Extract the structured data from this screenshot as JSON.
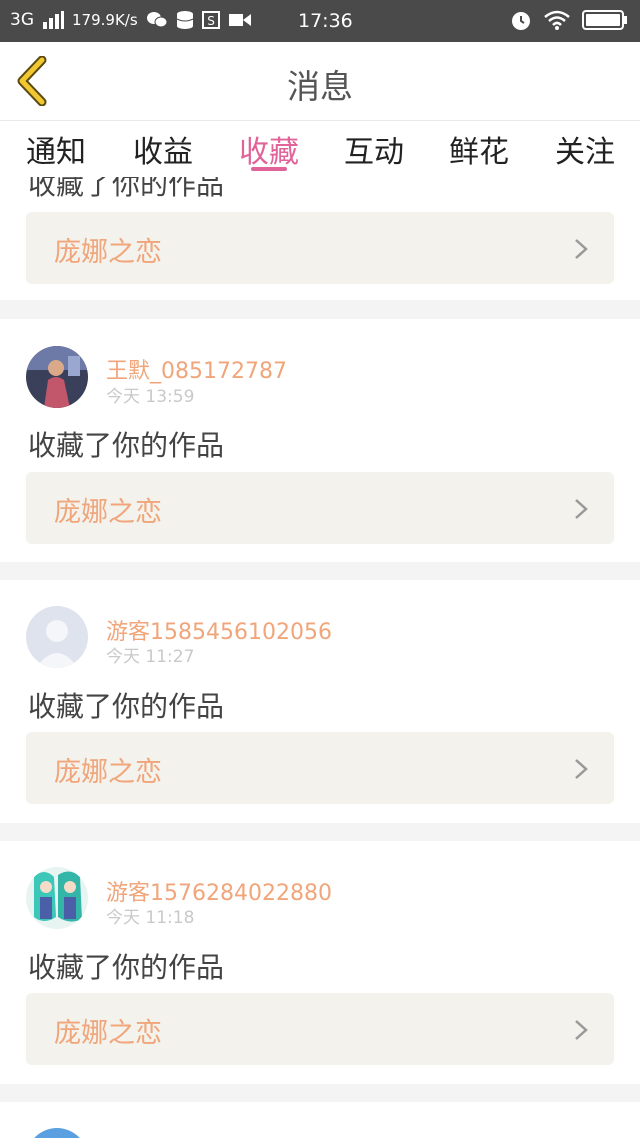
{
  "status_bar": {
    "network": "3G",
    "speed": "179.9K/s",
    "time": "17:36"
  },
  "header": {
    "title": "消息"
  },
  "tabs": [
    {
      "label": "通知",
      "active": false
    },
    {
      "label": "收益",
      "active": false
    },
    {
      "label": "收藏",
      "active": true
    },
    {
      "label": "互动",
      "active": false
    },
    {
      "label": "鲜花",
      "active": false
    },
    {
      "label": "关注",
      "active": false
    }
  ],
  "colors": {
    "accent": "#e0649a",
    "username": "#f0a57a",
    "status_bar_bg": "#4a4a4a"
  },
  "items": [
    {
      "action": "收藏了你的作品",
      "work_title": "庞娜之恋"
    },
    {
      "username": "王默_085172787",
      "time": "今天 13:59",
      "action": "收藏了你的作品",
      "work_title": "庞娜之恋",
      "avatar": "photo-avatar"
    },
    {
      "username": "游客1585456102056",
      "time": "今天 11:27",
      "action": "收藏了你的作品",
      "work_title": "庞娜之恋",
      "avatar": "default-avatar"
    },
    {
      "username": "游客1576284022880",
      "time": "今天 11:18",
      "action": "收藏了你的作品",
      "work_title": "庞娜之恋",
      "avatar": "anime-avatar"
    }
  ]
}
